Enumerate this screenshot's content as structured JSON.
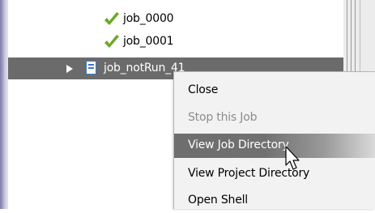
{
  "tree": {
    "rows": [
      {
        "label": "job_0000",
        "status": "completed"
      },
      {
        "label": "job_0001",
        "status": "completed"
      },
      {
        "label": "job_notRun_41",
        "status": "not-run",
        "selected": true
      }
    ]
  },
  "context_menu": {
    "items": [
      {
        "label": "Close",
        "enabled": true
      },
      {
        "label": "Stop this Job",
        "enabled": false
      },
      {
        "label": "View Job Directory",
        "enabled": true,
        "highlighted": true
      },
      {
        "label": "View Project Directory",
        "enabled": true
      },
      {
        "label": "Open Shell",
        "enabled": true
      }
    ]
  },
  "colors": {
    "selection": "#6b6b6b",
    "check": "#6ca823",
    "menu_background": "#f2f2f2",
    "disabled_text": "#8d8d8d",
    "file_icon": "#3a78c8"
  },
  "icons": {
    "completed": "check-icon",
    "expand": "triangle-right-icon",
    "job_file": "file-icon",
    "pointer": "mouse-cursor-icon"
  }
}
